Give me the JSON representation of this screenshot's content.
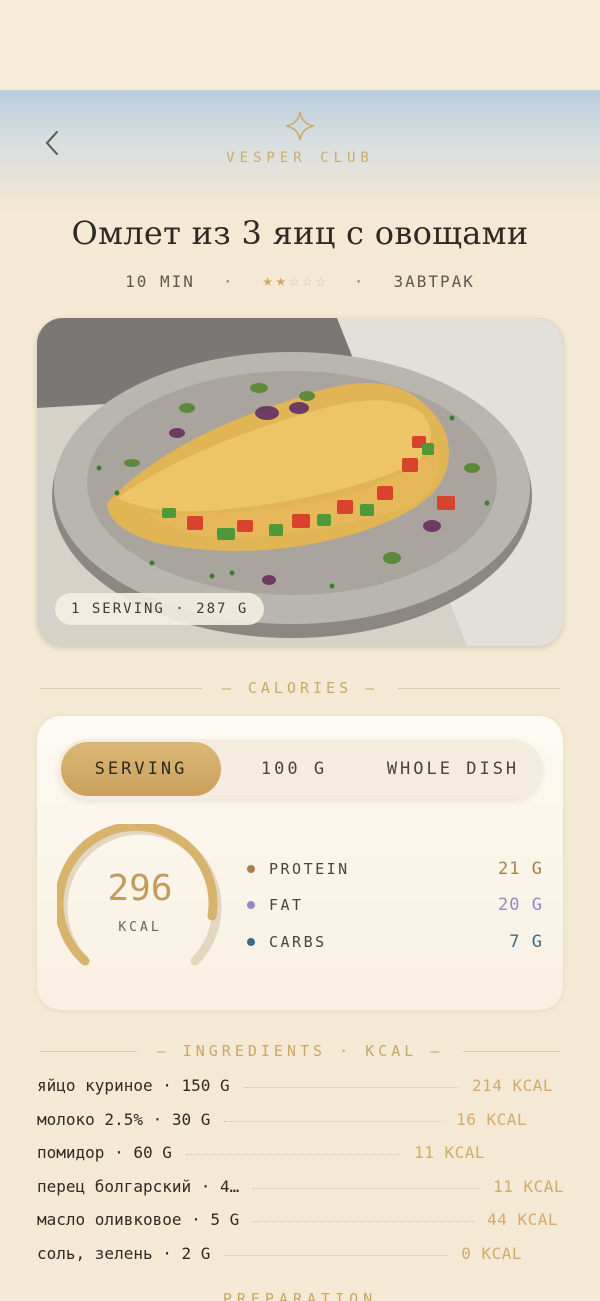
{
  "header": {
    "brand": "VESPER CLUB",
    "back_icon": "chevron-left-icon",
    "logo_icon": "four-point-star-icon"
  },
  "recipe": {
    "title": "Омлет из 3 яиц с овощами",
    "time": "10 MIN",
    "separator": "·",
    "rating": 2,
    "rating_max": 5,
    "category": "ЗАВТРАК",
    "photo_badge": "1 SERVING · 287 G"
  },
  "calories": {
    "section_label": "— CALORIES —",
    "tabs": [
      "SERVING",
      "100 G",
      "WHOLE DISH"
    ],
    "active_tab": 0,
    "kcal_value": "296",
    "kcal_unit": "KCAL",
    "macros": [
      {
        "name": "PROTEIN",
        "value": "21 G",
        "color": "#a8804e"
      },
      {
        "name": "FAT",
        "value": "20 G",
        "color": "#9b86c4"
      },
      {
        "name": "CARBS",
        "value": "7 G",
        "color": "#3f6c85"
      }
    ]
  },
  "ingredients": {
    "section_label": "— INGREDIENTS · KCAL —",
    "items": [
      {
        "name": "яйцо куриное · 150 G",
        "kcal": "214 KCAL"
      },
      {
        "name": "молоко 2.5% · 30 G",
        "kcal": "16 KCAL"
      },
      {
        "name": "помидор · 60 G",
        "kcal": "11 KCAL"
      },
      {
        "name": "перец болгарский · 4…",
        "kcal": "11 KCAL"
      },
      {
        "name": "масло оливковое · 5 G",
        "kcal": "44 KCAL"
      },
      {
        "name": "соль, зелень · 2 G",
        "kcal": "0 KCAL"
      }
    ]
  },
  "preparation": {
    "section_label": "PREPARATION"
  },
  "colors": {
    "accent_gold": "#c9a868",
    "background": "#f4e9d4"
  }
}
